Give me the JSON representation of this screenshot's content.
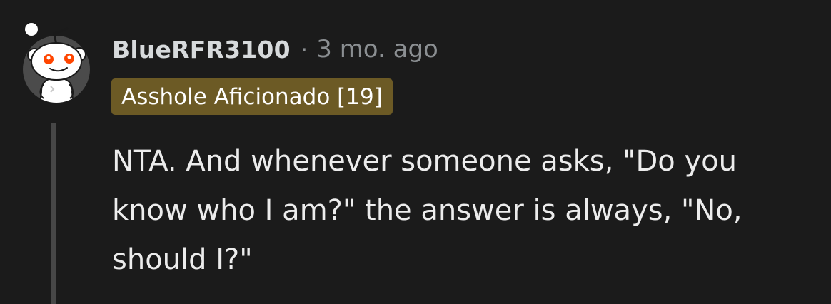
{
  "comment": {
    "username": "BlueRFR3100",
    "separator": "·",
    "timestamp": "3 mo. ago",
    "flair": "Asshole Aficionado [19]",
    "body": "NTA. And whenever someone asks, \"Do you know who I am?\" the answer is always, \"No, should I?\""
  },
  "icons": {
    "avatar": "reddit-snoo-avatar-icon"
  },
  "colors": {
    "background": "#1b1b1b",
    "flair_background": "#6c5a25",
    "username": "#d7dadc",
    "timestamp": "#8b8f92",
    "thread_line": "#474747"
  }
}
